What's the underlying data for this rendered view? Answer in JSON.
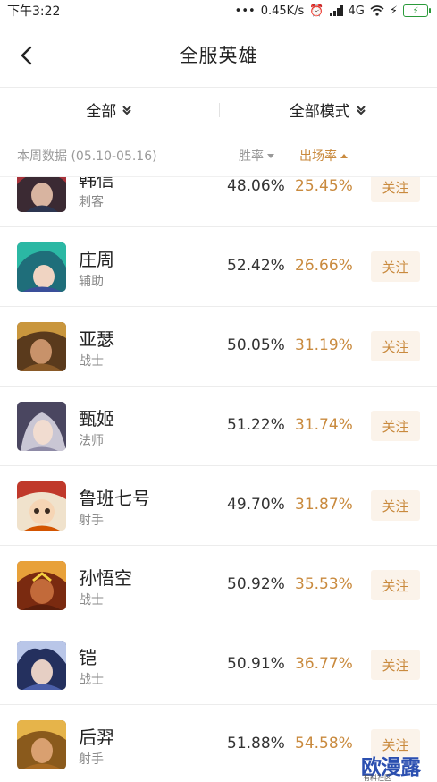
{
  "status_bar": {
    "time": "下午3:22",
    "speed": "0.45K/s",
    "network": "4G",
    "colors": {
      "battery": "#2a9a3a"
    }
  },
  "header": {
    "title": "全服英雄"
  },
  "filters": {
    "all": "全部",
    "modes": "全部模式"
  },
  "column_header": {
    "week": "本周数据 (05.10-05.16)",
    "win_rate": "胜率",
    "pick_rate": "出场率"
  },
  "heroes": [
    {
      "name": "韩信",
      "role": "刺客",
      "win": "48.06%",
      "pick": "25.45%",
      "follow": "关注"
    },
    {
      "name": "庄周",
      "role": "辅助",
      "win": "52.42%",
      "pick": "26.66%",
      "follow": "关注"
    },
    {
      "name": "亚瑟",
      "role": "战士",
      "win": "50.05%",
      "pick": "31.19%",
      "follow": "关注"
    },
    {
      "name": "甄姬",
      "role": "法师",
      "win": "51.22%",
      "pick": "31.74%",
      "follow": "关注"
    },
    {
      "name": "鲁班七号",
      "role": "射手",
      "win": "49.70%",
      "pick": "31.87%",
      "follow": "关注"
    },
    {
      "name": "孙悟空",
      "role": "战士",
      "win": "50.92%",
      "pick": "35.53%",
      "follow": "关注"
    },
    {
      "name": "铠",
      "role": "战士",
      "win": "50.91%",
      "pick": "36.77%",
      "follow": "关注"
    },
    {
      "name": "后羿",
      "role": "射手",
      "win": "51.88%",
      "pick": "54.58%",
      "follow": "关注"
    }
  ],
  "watermark": {
    "main": "欧漫露",
    "sub": "有料社区"
  },
  "colors": {
    "accent": "#c98a3e",
    "follow_bg": "#fbf3ea",
    "divider": "#ececec"
  }
}
